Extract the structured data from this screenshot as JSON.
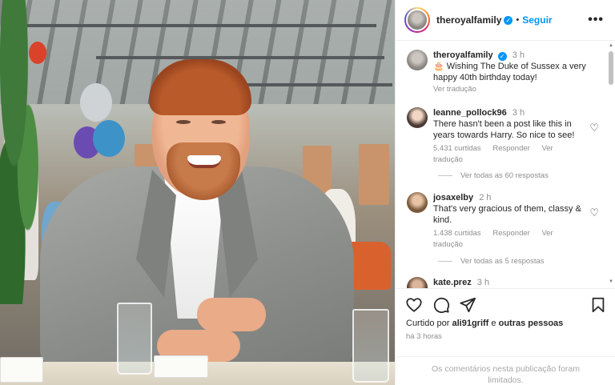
{
  "header": {
    "username": "theroyalfamily",
    "separator": "•",
    "follow_label": "Seguir",
    "more_label": "•••"
  },
  "caption": {
    "username": "theroyalfamily",
    "time": "3 h",
    "text": "🎂 Wishing The Duke of Sussex a very happy 40th birthday today!",
    "translate": "Ver tradução"
  },
  "comments": [
    {
      "username": "leanne_pollock96",
      "time": "3 h",
      "text": "There hasn't been a post like this in years towards Harry. So nice to see!",
      "likes": "5.431 curtidas",
      "reply": "Responder",
      "translate": "Ver tradução",
      "view_replies": "Ver todas as 60 respostas"
    },
    {
      "username": "josaxelby",
      "time": "2 h",
      "text": "That's very gracious of them, classy & kind.",
      "likes": "1.438 curtidas",
      "reply": "Responder",
      "translate": "Ver tradução",
      "view_replies": "Ver todas as 5 respostas"
    },
    {
      "username": "kate.prez",
      "time": "3 h"
    }
  ],
  "liked_by": {
    "prefix": "Curtido por",
    "user": "ali91griff",
    "joiner": "e",
    "others": "outras pessoas"
  },
  "post_time": "há 3 horas",
  "comments_limited": "Os comentários nesta publicação foram limitados.",
  "icons": {
    "verified": "verified-badge-icon",
    "heart": "heart-icon",
    "comment": "comment-icon",
    "share": "share-icon",
    "save": "bookmark-icon"
  },
  "colors": {
    "accent": "#0095f6",
    "muted": "#8e8e8e"
  }
}
